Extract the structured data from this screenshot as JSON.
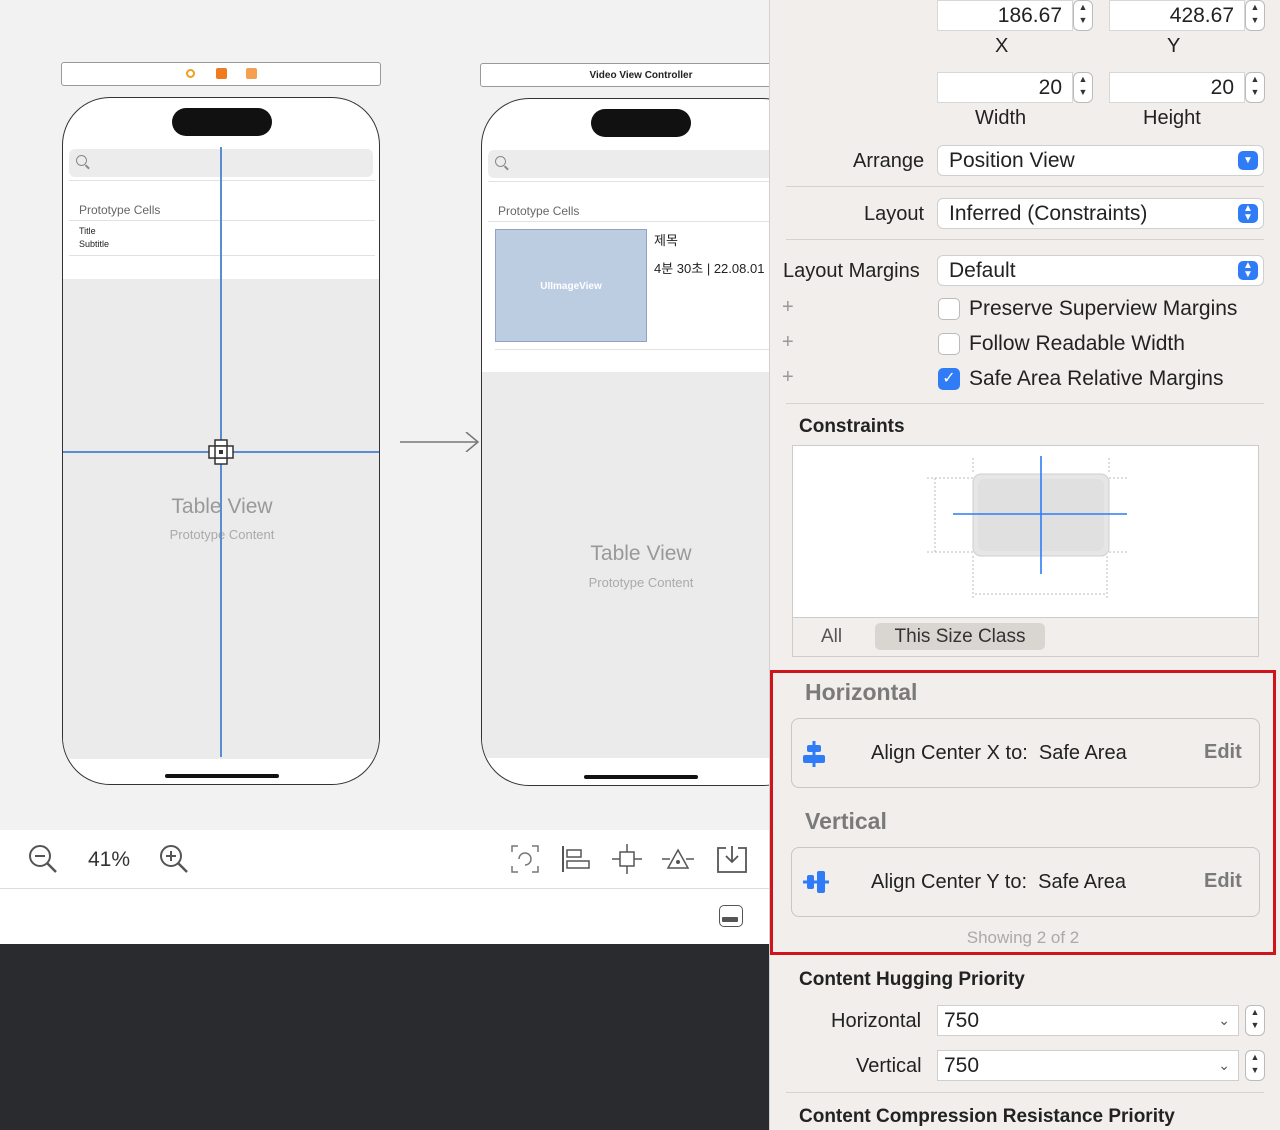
{
  "canvas": {
    "scene1": {
      "prototype_cells": "Prototype Cells",
      "cell_title": "Title",
      "cell_subtitle": "Subtitle",
      "table_view": "Table View",
      "prototype_content": "Prototype Content"
    },
    "scene2": {
      "title": "Video View Controller",
      "prototype_cells": "Prototype Cells",
      "image_view": "UIImageView",
      "cell_title": "제목",
      "cell_detail": "4분 30초 | 22.08.01",
      "table_view": "Table View",
      "prototype_content": "Prototype Content"
    }
  },
  "toolbar": {
    "zoom": "41%"
  },
  "inspector": {
    "x_value": "186.67",
    "x_label": "X",
    "y_value": "428.67",
    "y_label": "Y",
    "width_value": "20",
    "width_label": "Width",
    "height_value": "20",
    "height_label": "Height",
    "arrange_label": "Arrange",
    "arrange_value": "Position View",
    "layout_label": "Layout",
    "layout_value": "Inferred (Constraints)",
    "margins_label": "Layout Margins",
    "margins_value": "Default",
    "checkboxes": [
      {
        "label": "Preserve Superview Margins",
        "checked": false
      },
      {
        "label": "Follow Readable Width",
        "checked": false
      },
      {
        "label": "Safe Area Relative Margins",
        "checked": true
      }
    ],
    "constraints_title": "Constraints",
    "tab_all": "All",
    "tab_size_class": "This Size Class",
    "horizontal_title": "Horizontal",
    "horizontal_constraint": "Align Center X to:  Safe Area",
    "vertical_title": "Vertical",
    "vertical_constraint": "Align Center Y to:  Safe Area",
    "edit_label": "Edit",
    "showing": "Showing 2 of 2",
    "hugging_title": "Content Hugging Priority",
    "hug_h_label": "Horizontal",
    "hug_h_value": "750",
    "hug_v_label": "Vertical",
    "hug_v_value": "750",
    "compression_title": "Content Compression Resistance Priority",
    "highlight_color": "#d0141c",
    "accent_color": "#2f7cf6"
  }
}
